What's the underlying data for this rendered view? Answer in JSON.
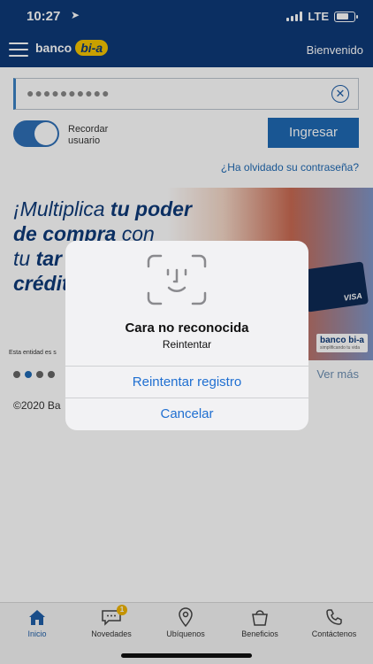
{
  "status": {
    "time": "10:27",
    "network": "LTE"
  },
  "header": {
    "logo_text": "banco",
    "logo_badge": "bi-a",
    "welcome": "Bienvenido"
  },
  "login": {
    "password_mask": "●●●●●●●●●●",
    "remember_label": "Recordar usuario",
    "remember_on": true,
    "submit_label": "Ingresar",
    "forgot_label": "¿Ha olvidado su contraseña?"
  },
  "banner": {
    "line1_a": "¡Multiplica ",
    "line1_b": "tu poder",
    "line2_a": "de compra ",
    "line2_b": "con",
    "line3_a": "tu ",
    "line3_b": "tar",
    "line4": "crédit",
    "card_brand": "VISA",
    "logo_text": "banco bi-a",
    "logo_tagline": "simplificando tu vida",
    "disclaimer": "Esta entidad es s"
  },
  "carousel": {
    "see_more": "Ver más",
    "active_index": 1
  },
  "footer": {
    "copyright": "©2020 Ba"
  },
  "dialog": {
    "title": "Cara no reconocida",
    "subtitle": "Reintentar",
    "retry_label": "Reintentar registro",
    "cancel_label": "Cancelar"
  },
  "tabs": [
    {
      "label": "Inicio",
      "icon": "home-icon"
    },
    {
      "label": "Novedades",
      "icon": "chat-icon",
      "badge": "1"
    },
    {
      "label": "Ubíquenos",
      "icon": "location-pin-icon"
    },
    {
      "label": "Beneficios",
      "icon": "bag-icon"
    },
    {
      "label": "Contáctenos",
      "icon": "phone-icon"
    }
  ],
  "colors": {
    "brand_blue": "#0e3a78",
    "accent_yellow": "#f4c400",
    "link_blue": "#1f6fd1"
  }
}
